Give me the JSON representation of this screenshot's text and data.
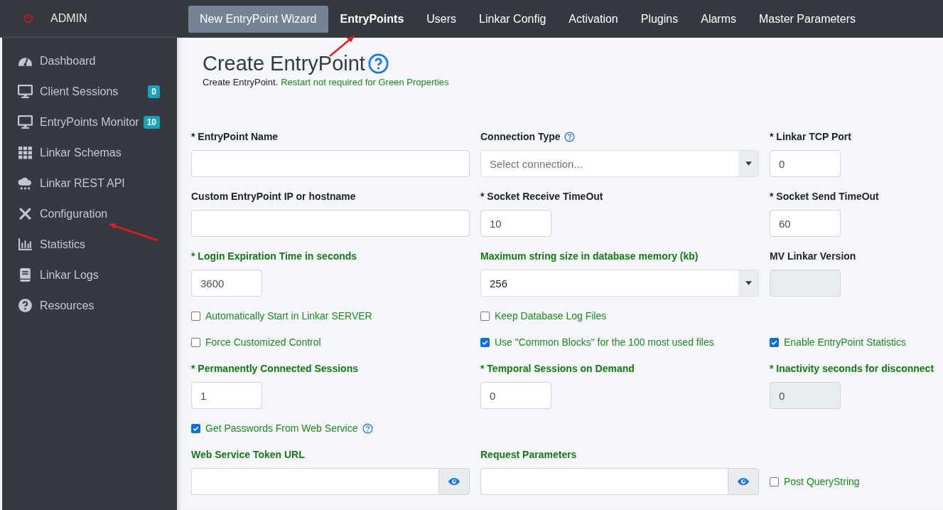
{
  "sidebar": {
    "title": "ADMIN",
    "items": [
      {
        "label": "Dashboard"
      },
      {
        "label": "Client Sessions",
        "badge": "0"
      },
      {
        "label": "EntryPoints Monitor",
        "badge": "10"
      },
      {
        "label": "Linkar Schemas"
      },
      {
        "label": "Linkar REST API"
      },
      {
        "label": "Configuration"
      },
      {
        "label": "Statistics"
      },
      {
        "label": "Linkar Logs"
      },
      {
        "label": "Resources"
      }
    ]
  },
  "topbar": {
    "items": [
      {
        "label": "New EntryPoint Wizard",
        "kind": "button",
        "selected": false
      },
      {
        "label": "EntryPoints",
        "kind": "tab",
        "selected": true
      },
      {
        "label": "Users",
        "kind": "tab",
        "selected": false
      },
      {
        "label": "Linkar Config",
        "kind": "tab",
        "selected": false
      },
      {
        "label": "Activation",
        "kind": "tab",
        "selected": false
      },
      {
        "label": "Plugins",
        "kind": "tab",
        "selected": false
      },
      {
        "label": "Alarms",
        "kind": "tab",
        "selected": false
      },
      {
        "label": "Master Parameters",
        "kind": "tab",
        "selected": false
      }
    ]
  },
  "page": {
    "title": "Create EntryPoint",
    "subtitle": "Create EntryPoint.",
    "note": "Restart not required for Green Properties"
  },
  "form": {
    "rows": [
      [
        {
          "kind": "text",
          "label": "* EntryPoint Name",
          "green": false
        },
        {
          "kind": "select",
          "label": "Connection Type",
          "help": true,
          "green": false,
          "placeholder": "Select connection..."
        },
        {
          "kind": "short",
          "label": "* Linkar TCP Port",
          "green": false,
          "value": "0"
        }
      ],
      [
        {
          "kind": "text",
          "label": "Custom EntryPoint IP or hostname",
          "green": false
        },
        {
          "kind": "short",
          "label": "* Socket Receive TimeOut",
          "green": false,
          "value": "10"
        },
        {
          "kind": "short",
          "label": "* Socket Send TimeOut",
          "green": false,
          "value": "60"
        }
      ],
      [
        {
          "kind": "short",
          "label": "* Login Expiration Time in seconds",
          "green": true,
          "value": "3600"
        },
        {
          "kind": "select",
          "label": "Maximum string size in database memory (kb)",
          "green": true,
          "value": "256"
        },
        {
          "kind": "short",
          "label": "MV Linkar Version",
          "green": false,
          "disabled": true
        }
      ],
      [
        {
          "kind": "checkbox",
          "label": "Automatically Start in Linkar SERVER",
          "checked": false
        },
        {
          "kind": "checkbox",
          "label": "Keep Database Log Files",
          "checked": false
        }
      ],
      [
        {
          "kind": "checkbox",
          "label": "Force Customized Control",
          "checked": false
        },
        {
          "kind": "checkbox",
          "label": "Use \"Common Blocks\" for the 100 most used files",
          "checked": true
        },
        {
          "kind": "checkbox",
          "label": "Enable EntryPoint Statistics",
          "checked": true
        }
      ],
      [
        {
          "kind": "short",
          "label": "* Permanently Connected Sessions",
          "green": true,
          "value": "1"
        },
        {
          "kind": "short",
          "label": "* Temporal Sessions on Demand",
          "green": true,
          "value": "0"
        },
        {
          "kind": "short",
          "label": "* Inactivity seconds for disconnect",
          "green": true,
          "value": "0",
          "disabled": true
        }
      ],
      [
        {
          "kind": "checkbox",
          "label": "Get Passwords From Web Service",
          "checked": true,
          "help": true
        }
      ],
      [
        {
          "kind": "secret",
          "label": "Web Service Token URL",
          "green": true
        },
        {
          "kind": "secret",
          "label": "Request Parameters",
          "green": true
        },
        {
          "kind": "checkbox",
          "label": "Post QueryString",
          "checked": false,
          "inline": true
        }
      ]
    ]
  }
}
